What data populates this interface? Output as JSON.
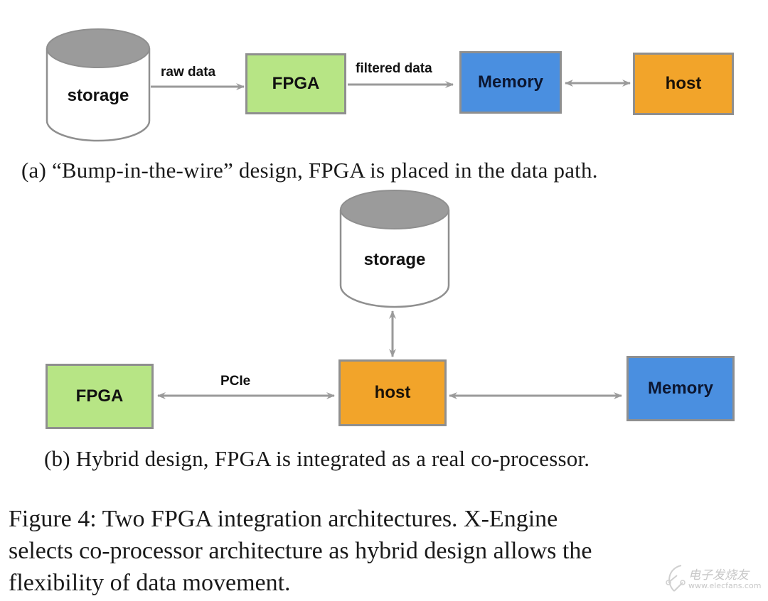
{
  "colors": {
    "fpga": "#b7e585",
    "memory": "#4a8fe0",
    "host": "#f2a42a",
    "cylinder_top": "#9b9b9b",
    "edge": "#9a9a9a"
  },
  "diagram_a": {
    "storage_label": "storage",
    "fpga_label": "FPGA",
    "memory_label": "Memory",
    "host_label": "host",
    "edges": [
      {
        "from": "storage",
        "to": "FPGA",
        "label": "raw data",
        "direction": "forward"
      },
      {
        "from": "FPGA",
        "to": "Memory",
        "label": "filtered data",
        "direction": "forward"
      },
      {
        "from": "Memory",
        "to": "host",
        "label": "",
        "direction": "bidirectional"
      }
    ],
    "caption": "(a) “Bump-in-the-wire” design, FPGA is placed in the data path."
  },
  "diagram_b": {
    "storage_label": "storage",
    "fpga_label": "FPGA",
    "host_label": "host",
    "memory_label": "Memory",
    "edges": [
      {
        "from": "storage",
        "to": "host",
        "label": "",
        "direction": "bidirectional"
      },
      {
        "from": "FPGA",
        "to": "host",
        "label": "PCIe",
        "direction": "bidirectional"
      },
      {
        "from": "host",
        "to": "Memory",
        "label": "",
        "direction": "bidirectional"
      }
    ],
    "caption": "(b) Hybrid design, FPGA is integrated as a real co-processor."
  },
  "figure_caption": {
    "lines": [
      "Figure 4:  Two FPGA integration architectures.  X-Engine",
      "selects co-processor architecture as hybrid design allows the",
      "flexibility of data movement."
    ]
  },
  "watermark": {
    "title": "电子发烧友",
    "url": "www.elecfans.com"
  }
}
